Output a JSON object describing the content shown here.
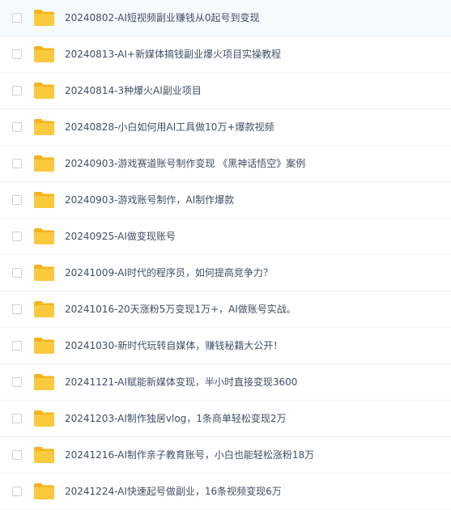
{
  "colors": {
    "folder_body": "#f9ca3e",
    "folder_tab": "#f5b31f",
    "text": "#424e67",
    "divider": "#f0f0f0",
    "checkbox_border": "#cfcfcf"
  },
  "files": [
    {
      "name": "20240802-AI短视频副业赚钱从0起号到变现",
      "icon": "folder-icon"
    },
    {
      "name": "20240813-AI+新媒体搞钱副业爆火项目实操教程",
      "icon": "folder-icon"
    },
    {
      "name": "20240814-3种爆火AI副业项目",
      "icon": "folder-icon"
    },
    {
      "name": "20240828-小白如何用AI工具做10万+爆款视频",
      "icon": "folder-icon"
    },
    {
      "name": "20240903-游戏赛道账号制作变现 《黑神话悟空》案例",
      "icon": "folder-icon"
    },
    {
      "name": "20240903-游戏账号制作，AI制作爆款",
      "icon": "folder-icon"
    },
    {
      "name": "20240925-AI做变现账号",
      "icon": "folder-icon"
    },
    {
      "name": "20241009-AI时代的程序员，如何提高竞争力？",
      "icon": "folder-icon"
    },
    {
      "name": "20241016-20天涨粉5万变现1万+，AI做账号实战。",
      "icon": "folder-icon"
    },
    {
      "name": "20241030-新时代玩转自媒体，赚钱秘籍大公开！",
      "icon": "folder-icon"
    },
    {
      "name": "20241121-AI赋能新媒体变现，半小时直接变现3600",
      "icon": "folder-icon"
    },
    {
      "name": "20241203-AI制作独居vlog，1条商单轻松变现2万",
      "icon": "folder-icon"
    },
    {
      "name": "20241216-AI制作亲子教育账号，小白也能轻松涨粉18万",
      "icon": "folder-icon"
    },
    {
      "name": "20241224-AI快速起号做副业，16条视频变现6万",
      "icon": "folder-icon"
    }
  ]
}
